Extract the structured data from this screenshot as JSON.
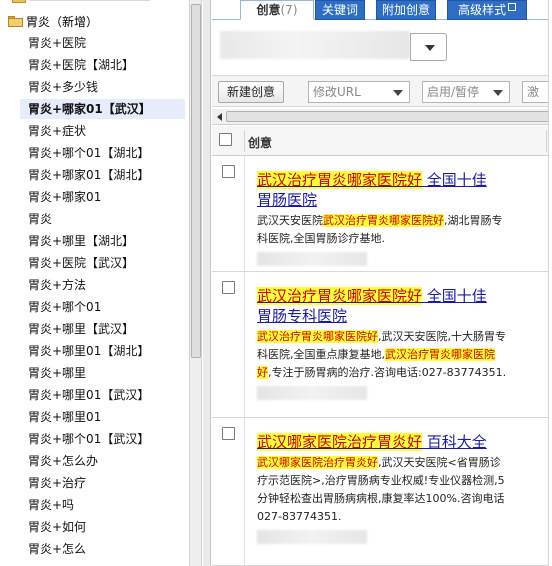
{
  "tree": {
    "root_label": "胃炎（新增）",
    "items": [
      {
        "label": "胃炎+医院",
        "selected": false
      },
      {
        "label": "胃炎+医院【湖北】",
        "selected": false
      },
      {
        "label": "胃炎+多少钱",
        "selected": false
      },
      {
        "label": "胃炎+哪家01【武汉】",
        "selected": true
      },
      {
        "label": "胃炎+症状",
        "selected": false
      },
      {
        "label": "胃炎+哪个01【湖北】",
        "selected": false
      },
      {
        "label": "胃炎+哪家01【湖北】",
        "selected": false
      },
      {
        "label": "胃炎+哪家01",
        "selected": false
      },
      {
        "label": "胃炎",
        "selected": false
      },
      {
        "label": "胃炎+哪里【湖北】",
        "selected": false
      },
      {
        "label": "胃炎+医院【武汉】",
        "selected": false
      },
      {
        "label": "胃炎+方法",
        "selected": false
      },
      {
        "label": "胃炎+哪个01",
        "selected": false
      },
      {
        "label": "胃炎+哪里【武汉】",
        "selected": false
      },
      {
        "label": "胃炎+哪里01【湖北】",
        "selected": false
      },
      {
        "label": "胃炎+哪里",
        "selected": false
      },
      {
        "label": "胃炎+哪里01【武汉】",
        "selected": false
      },
      {
        "label": "胃炎+哪里01",
        "selected": false
      },
      {
        "label": "胃炎+哪个01【武汉】",
        "selected": false
      },
      {
        "label": "胃炎+怎么办",
        "selected": false
      },
      {
        "label": "胃炎+治疗",
        "selected": false
      },
      {
        "label": "胃炎+吗",
        "selected": false
      },
      {
        "label": "胃炎+如何",
        "selected": false
      },
      {
        "label": "胃炎+怎么",
        "selected": false
      }
    ]
  },
  "tabs": {
    "creative": "创意",
    "creative_count": "(7)",
    "keywords": "关键词",
    "extra_creative": "附加创意",
    "advanced": "高级样式"
  },
  "toolbar": {
    "new_creative": "新建创意",
    "modify_url": "修改URL",
    "enable_pause": "启用/暂停",
    "cut_label": "激"
  },
  "table": {
    "header_creative": "创意"
  },
  "ads": [
    {
      "title_hl": "武汉治疗胃炎哪家医院好",
      "title_rest_line1": " 全国十佳",
      "title_line2": "胃肠医院",
      "desc": [
        {
          "t": "武汉天安医院",
          "hl": false
        },
        {
          "t": "武汉治疗胃炎哪家医院好",
          "hl": true
        },
        {
          "t": ",湖北胃肠专科医院,全国胃肠诊疗基地.",
          "hl": false
        }
      ]
    },
    {
      "title_hl": "武汉治疗胃炎哪家医院好",
      "title_rest_line1": " 全国十佳",
      "title_line2": "胃肠专科医院",
      "desc": [
        {
          "t": "武汉治疗胃炎哪家医院好",
          "hl": true
        },
        {
          "t": ",武汉天安医院,十大肠胃专科医院,全国重点康复基地,",
          "hl": false
        },
        {
          "t": "武汉治疗胃炎哪家医院好",
          "hl": true
        },
        {
          "t": ",专注于肠胃病的治疗.咨询电话:027-83774351.",
          "hl": false
        }
      ]
    },
    {
      "title_hl": "武汉哪家医院治疗胃炎好",
      "title_rest_line1": " 百科大全",
      "title_line2": "",
      "desc": [
        {
          "t": "武汉哪家医院治疗胃炎好",
          "hl": true
        },
        {
          "t": ",武汉天安医院<省胃肠诊疗示范医院>,治疗胃肠病专业权威!专业仪器检测,5分钟轻松查出胃肠病病根,康复率达100%.咨询电话027-83774351.",
          "hl": false
        }
      ]
    }
  ],
  "colors": {
    "tab_blue": "#2f6dc4",
    "highlight": "#ffff3a",
    "link": "#1a1aa8"
  }
}
